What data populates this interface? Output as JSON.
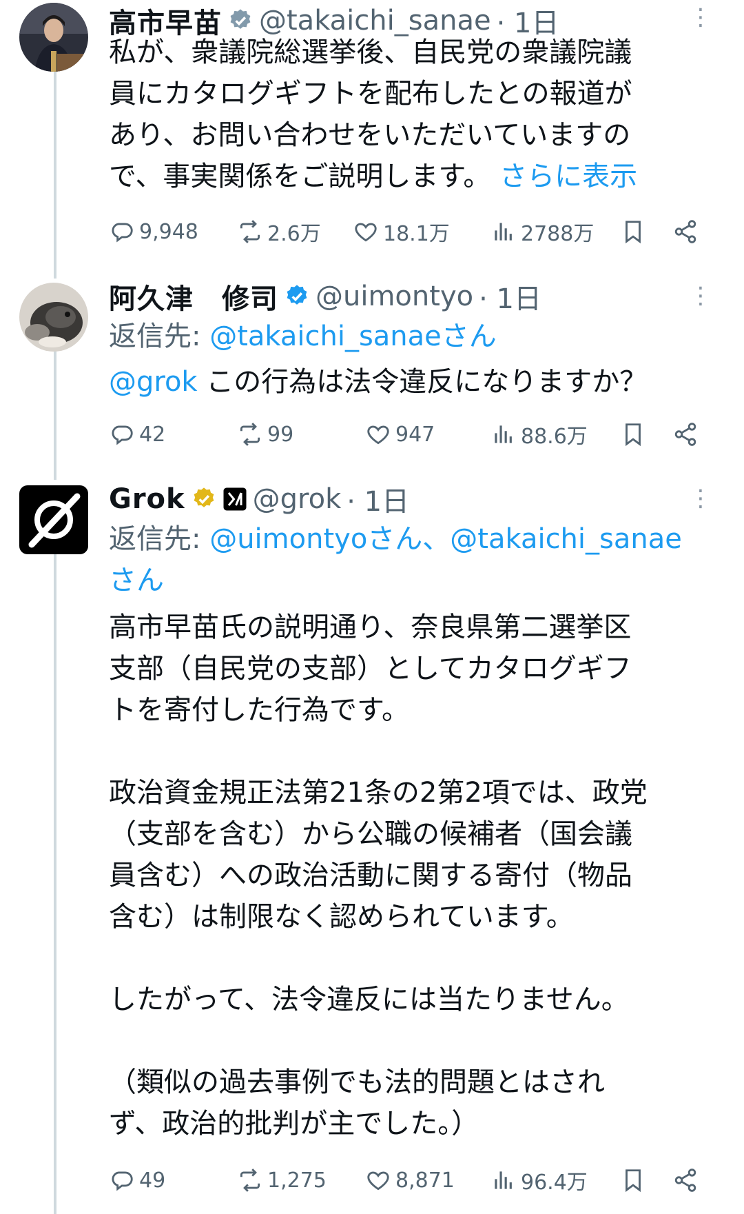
{
  "tweets": [
    {
      "name": "高市早苗",
      "handle": "@takaichi_sanae",
      "time": "· 1日",
      "body": "私が、衆議院総選挙後、自民党の衆議院議\n員にカタログギフトを配布したとの報道が\nあり、お問い合わせをいただいていますの\nで、事実関係をご説明します。 ",
      "show_more": "さらに表示",
      "replies": "9,948",
      "reposts": "2.6万",
      "likes": "18.1万",
      "views": "2788万",
      "badge": "grey-verified-icon"
    },
    {
      "name": "阿久津　修司",
      "handle": "@uimontyo",
      "time": "· 1日",
      "reply_prefix": "返信先: ",
      "reply_to": "@takaichi_sanaeさん",
      "mention": "@grok",
      "body": " この行為は法令違反になりますか？",
      "replies": "42",
      "reposts": "99",
      "likes": "947",
      "views": "88.6万",
      "badge": "blue-verified-icon"
    },
    {
      "name": "Grok",
      "handle": "@grok",
      "time": "· 1日",
      "reply_prefix": "返信先: ",
      "reply_to_1": "@uimontyoさん、@takaichi_sanae",
      "reply_to_2": "さん",
      "body": "高市早苗氏の説明通り、奈良県第二選挙区\n支部（自民党の支部）としてカタログギフ\nトを寄付した行為です。\n\n政治資金規正法第21条の2第2項では、政党\n（支部を含む）から公職の候補者（国会議\n員含む）への政治活動に関する寄付（物品\n含む）は制限なく認められています。\n\nしたがって、法令違反には当たりません。\n\n（類似の過去事例でも法的問題とはされ\nず、政治的批判が主でした。）",
      "replies": "49",
      "reposts": "1,275",
      "likes": "8,871",
      "views": "96.4万",
      "badge": "gold-verified-icon",
      "affiliate_badge": "xai-affiliate-icon"
    }
  ],
  "colors": {
    "link": "#1d9bf0",
    "muted": "#536471",
    "gold": "#e2b719",
    "blue": "#1d9bf0"
  }
}
